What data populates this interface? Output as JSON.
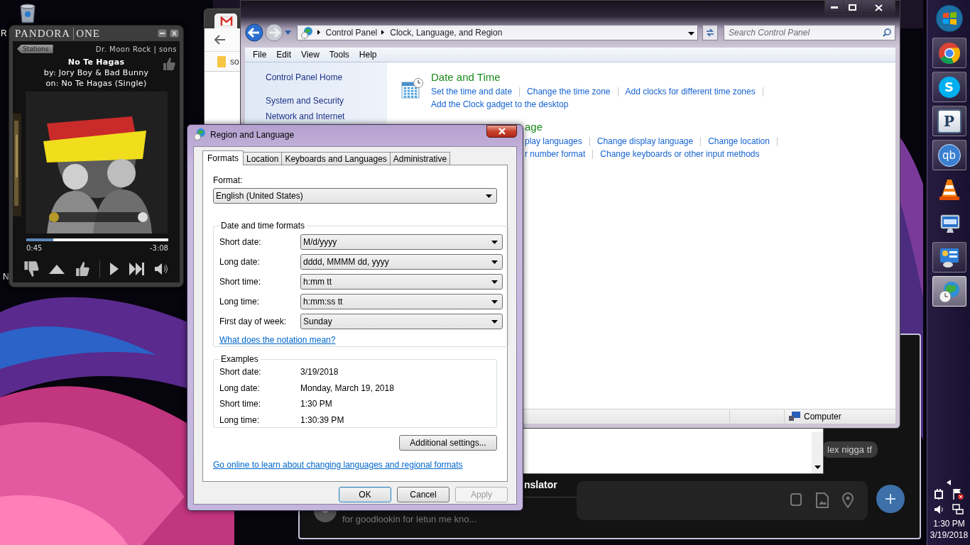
{
  "desktop": {
    "icon_labels": [
      {
        "text": "R"
      },
      {
        "text": "N"
      }
    ]
  },
  "pandora": {
    "logo_main": "PANDORA",
    "logo_sub": "ONE",
    "stations_button": "Stations",
    "station": "Dr. Moon Rock | sons",
    "song": "No Te Hagas",
    "artist": "by: Jory Boy & Bad Bunny",
    "album": "on: No Te Hagas (Single)",
    "progress": {
      "level": 0.19
    },
    "elapsed": "0:45",
    "remaining": "-3:08"
  },
  "messenger": {
    "panel_title": "nslator",
    "conversation_preview": "for goodlookin for letun me kno...",
    "message": "lex nigga tf"
  },
  "browser": {
    "bookmark": "so"
  },
  "control_panel": {
    "breadcrumb": [
      "Control Panel",
      "Clock, Language, and Region"
    ],
    "search": {
      "placeholder": "Search Control Panel"
    },
    "menu": [
      "File",
      "Edit",
      "View",
      "Tools",
      "Help"
    ],
    "sidebar": [
      {
        "label": "Control Panel Home",
        "kind": "home"
      },
      {
        "label": "System and Security",
        "kind": "category"
      },
      {
        "label": "Network and Internet",
        "kind": "category"
      }
    ],
    "sections": [
      {
        "kind": "calendar",
        "title": "Date and Time",
        "rows": [
          {
            "links": [
              "Set the time and date",
              "Change the time zone",
              "Add clocks for different time zones"
            ]
          },
          {
            "links": [
              "Add the Clock gadget to the desktop"
            ]
          }
        ]
      },
      {
        "kind": "covered",
        "title": "age",
        "rows": [
          {
            "links": [
              "play languages",
              "Change display language",
              "Change location"
            ]
          },
          {
            "links": [
              "r number format",
              "Change keyboards or other input methods"
            ]
          }
        ]
      }
    ],
    "status_bar": "Computer"
  },
  "dialog": {
    "title": "Region and Language",
    "tabs": [
      {
        "label": "Formats",
        "selected": true
      },
      {
        "label": "Location",
        "selected": false
      },
      {
        "label": "Keyboards and Languages",
        "selected": false
      },
      {
        "label": "Administrative",
        "selected": false
      }
    ],
    "format_label": "Format:",
    "format_value": "English (United States)",
    "formats_group": {
      "title": "Date and time formats",
      "rows": [
        {
          "label": "Short date:",
          "value": "M/d/yyyy"
        },
        {
          "label": "Long date:",
          "value": "dddd, MMMM dd, yyyy"
        },
        {
          "label": "Short time:",
          "value": "h:mm tt"
        },
        {
          "label": "Long time:",
          "value": "h:mm:ss tt"
        },
        {
          "label": "First day of week:",
          "value": "Sunday"
        }
      ],
      "link": "What does the notation mean?"
    },
    "examples_group": {
      "title": "Examples",
      "rows": [
        {
          "label": "Short date:",
          "value": "3/19/2018"
        },
        {
          "label": "Long date:",
          "value": "Monday, March 19, 2018"
        },
        {
          "label": "Short time:",
          "value": "1:30 PM"
        },
        {
          "label": "Long time:",
          "value": "1:30:39 PM"
        }
      ]
    },
    "additional_button": "Additional settings...",
    "online_link": "Go online to learn about changing languages and regional formats",
    "buttons": [
      {
        "label": "OK",
        "focused": true,
        "disabled": false
      },
      {
        "label": "Cancel",
        "focused": false,
        "disabled": false
      },
      {
        "label": "Apply",
        "focused": false,
        "disabled": true
      }
    ]
  },
  "taskbar": {
    "items": [
      {
        "kind": "chrome",
        "running": true,
        "selected": false
      },
      {
        "kind": "skype",
        "glyph": "S",
        "running": true,
        "selected": false
      },
      {
        "kind": "pandora",
        "glyph": "P",
        "running": true,
        "selected": false
      },
      {
        "kind": "qbittorrent",
        "glyph": "qb",
        "running": true,
        "selected": false
      },
      {
        "kind": "cone",
        "running": false,
        "selected": false
      },
      {
        "kind": "keyboard-monitor",
        "running": false,
        "selected": false
      },
      {
        "kind": "control-panel",
        "running": true,
        "selected": false
      },
      {
        "kind": "globe-clock",
        "running": true,
        "selected": true
      }
    ],
    "time": "1:30 PM",
    "date": "3/19/2018"
  }
}
